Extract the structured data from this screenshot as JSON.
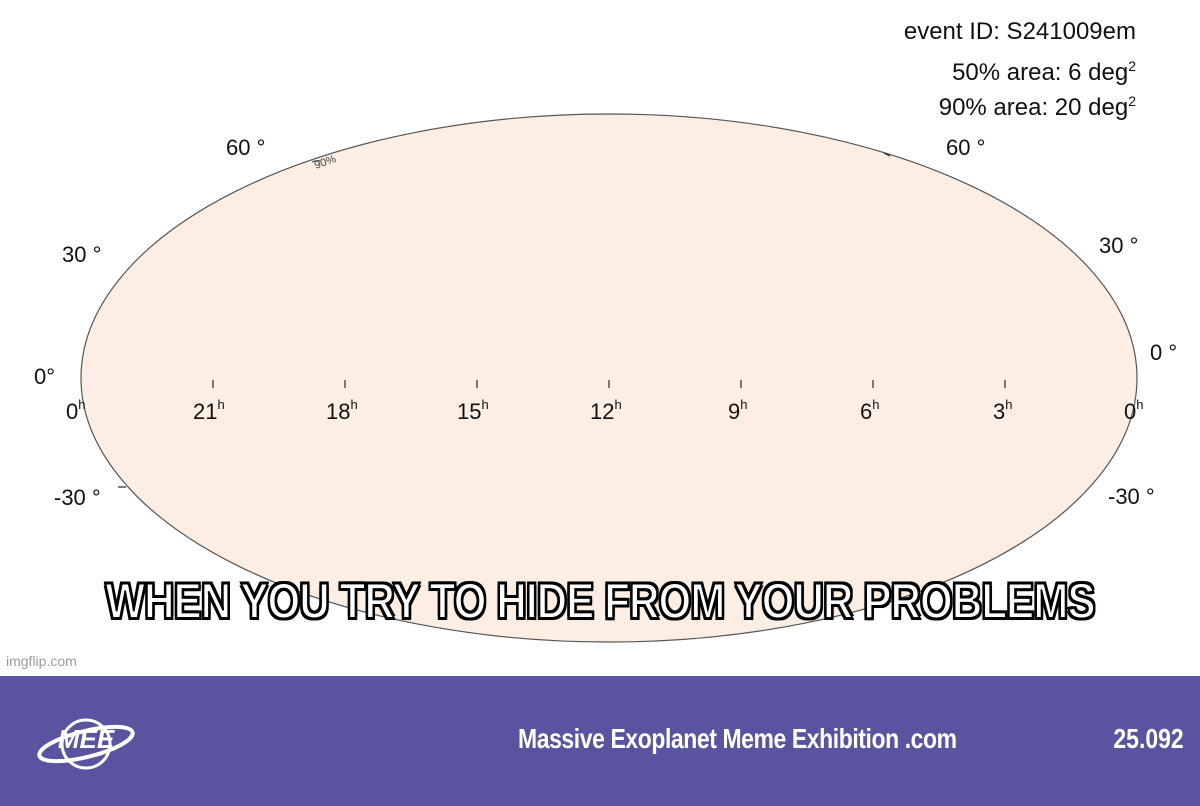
{
  "annotations": {
    "event_id": "event ID: S241009em",
    "area50_prefix": "50% area: 6 deg",
    "area90_prefix": "90% area: 20 deg",
    "sup": "2"
  },
  "skymap": {
    "fill": "#fdeee3",
    "outline": "#555555",
    "contour_label": "90%",
    "ra_labels": [
      "0",
      "21",
      "18",
      "15",
      "12",
      "9",
      "6",
      "3",
      "0"
    ],
    "ra_unit": "h",
    "dec_left_labels": [
      "60 °",
      "30 °",
      "0°",
      "-30 °"
    ],
    "dec_right_labels": [
      "60 °",
      "30 °",
      "0 °",
      "-30 °"
    ]
  },
  "caption": "WHEN YOU TRY TO HIDE FROM YOUR PROBLEMS",
  "watermark": "imgflip.com",
  "footer": {
    "site": "Massive Exoplanet Meme Exhibition .com",
    "number": "25.092",
    "logo_icon": "mee-globe-logo-icon",
    "background": "#5a539f"
  }
}
